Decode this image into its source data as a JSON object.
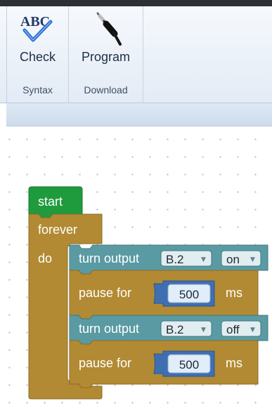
{
  "ribbon": {
    "groups": [
      {
        "label": "Syntax",
        "button": {
          "label": "Check",
          "icon": "abc-spellcheck-icon"
        }
      },
      {
        "label": "Download",
        "button": {
          "label": "Program",
          "icon": "audio-jack-cable-icon"
        }
      }
    ]
  },
  "blocks": {
    "start": {
      "label": "start"
    },
    "loop": {
      "label": "forever",
      "do_label": "do"
    },
    "statements": [
      {
        "type": "turn_output",
        "label": "turn output",
        "pin": "B.2",
        "state": "on"
      },
      {
        "type": "pause",
        "label": "pause for",
        "value": "500",
        "unit": "ms"
      },
      {
        "type": "turn_output",
        "label": "turn output",
        "pin": "B.2",
        "state": "off"
      },
      {
        "type": "pause",
        "label": "pause for",
        "value": "500",
        "unit": "ms"
      }
    ]
  },
  "colors": {
    "start_block": "#1f9a3c",
    "loop_block": "#b28a33",
    "output_block": "#5a9aa3",
    "pause_block": "#b28a33",
    "number_field": "#e1edf9",
    "ribbon_bg": "#e8eff8"
  }
}
